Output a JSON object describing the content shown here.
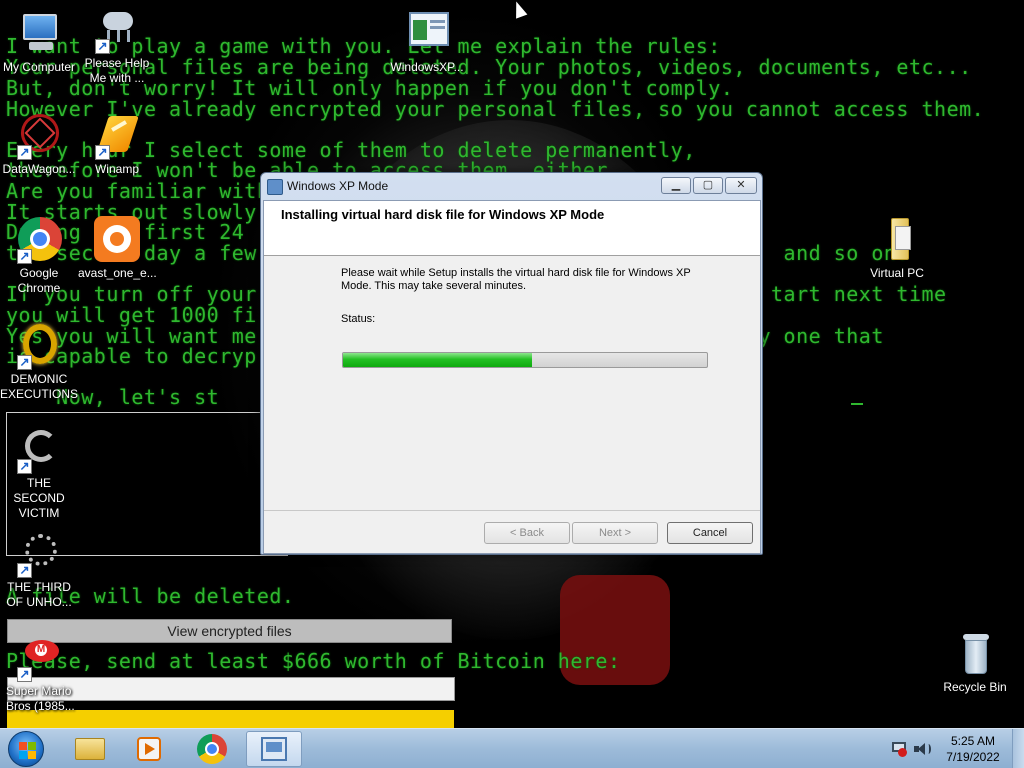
{
  "ransom": {
    "lines": [
      "I want to play a game with you. Let me explain the rules:",
      "Your personal files are being deleted. Your photos, videos, documents, etc...",
      "But, don't worry! It will only happen if you don't comply.",
      "However I've already encrypted your personal files, so you cannot access them.",
      "Every hour I select some of them to delete permanently,",
      "therefore I won't be able to access them, either.",
      "Are you familiar with Bitcoin? If not, let me help you out.",
      "It starts out slowly",
      "During the first 24",
      "the second day a few                                          and so on.",
      "If you turn off your                                         tart next time",
      "you will get 1000 fi",
      "Yes you will want me                                        y one that",
      "is capable to decryp",
      "    Now, let's st"
    ],
    "deleted_line": "A file will be deleted.",
    "bitcoin_line": "Please, send at least $666 worth of Bitcoin here:",
    "view_button": "View encrypted files"
  },
  "desktop_icons": [
    {
      "label": "My Computer",
      "icon": "computer-icon",
      "color": "#4a8fd8"
    },
    {
      "label": "Please Help Me with ...",
      "icon": "cloud-icon",
      "color": "#b9c6d6"
    },
    {
      "label": "WindowsXP...",
      "icon": "window-icon",
      "color": "#d8e6f5"
    },
    {
      "label": "DataWagon...",
      "icon": "wagon-icon",
      "color": "#c81e1e"
    },
    {
      "label": "Winamp",
      "icon": "winamp-icon",
      "color": "#f0a400"
    },
    {
      "label": "Google Chrome",
      "icon": "chrome-icon",
      "color": "#dd4b39"
    },
    {
      "label": "avast_one_e...",
      "icon": "avast-icon",
      "color": "#f47b20"
    },
    {
      "label": "Virtual PC",
      "icon": "folder-icon",
      "color": "#f2d46b"
    },
    {
      "label": "DEMONIC EXECUTIONS",
      "icon": "ring-icon",
      "color": "#d9a400"
    },
    {
      "label": "THE SECOND VICTIM",
      "icon": "loader-icon",
      "color": "#bdbdbd"
    },
    {
      "label": "THE THIRD OF UNHO...",
      "icon": "loader-icon",
      "color": "#bdbdbd"
    },
    {
      "label": "Super Mario Bros (1985...",
      "icon": "mario-icon",
      "color": "#e02424"
    },
    {
      "label": "Recycle Bin",
      "icon": "recycle-bin-icon",
      "color": "#a9c3d8"
    }
  ],
  "installer": {
    "window_title": "Windows XP Mode",
    "header_title": "Installing virtual hard disk file for Windows XP Mode",
    "message": "Please wait while Setup installs the virtual hard disk file for Windows XP Mode. This may take several minutes.",
    "status_label": "Status:",
    "progress": 0.52,
    "buttons": {
      "back": "< Back",
      "next": "Next >",
      "cancel": "Cancel"
    }
  },
  "taskbar": {
    "items": [
      "explorer-icon",
      "media-player-icon",
      "chrome-icon",
      "setup-icon"
    ],
    "clock": {
      "time": "5:25 AM",
      "date": "7/19/2022"
    },
    "tray": [
      "network-warning-icon",
      "volume-icon"
    ]
  },
  "colors": {
    "ransom_text": "#2fb82f",
    "progress": "#1fbd1f",
    "taskbar": "#9dbbd9"
  }
}
